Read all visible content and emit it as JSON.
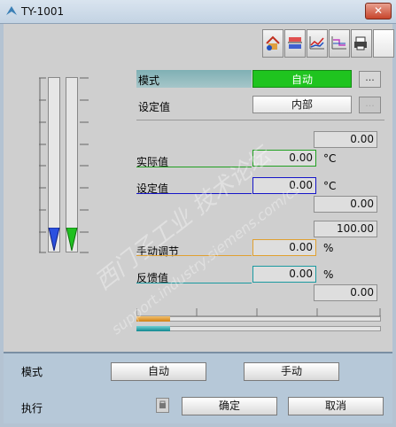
{
  "window": {
    "title": "TY-1001",
    "close_symbol": "✕"
  },
  "toolbar": {
    "icons": [
      "home-icon",
      "swap-icon",
      "trend-icon",
      "curve-icon",
      "print-icon"
    ],
    "blank_button": ""
  },
  "mode_row": {
    "label": "模式",
    "value": "自动",
    "dots": "..."
  },
  "setpoint_row": {
    "label": "设定值",
    "value": "内部",
    "dots": "..."
  },
  "values": {
    "top_value": "0.00",
    "actual_label": "实际值",
    "actual_value": "0.00",
    "actual_unit": "°C",
    "setpoint_label": "设定值",
    "setpoint_value": "0.00",
    "setpoint_unit": "°C",
    "lower_value": "0.00",
    "range_value": "100.00",
    "manual_label": "手动调节",
    "manual_value": "0.00",
    "manual_unit": "%",
    "feedback_label": "反馈值",
    "feedback_value": "0.00",
    "feedback_unit": "%",
    "bottom_value": "0.00"
  },
  "colors": {
    "actual": "#22a022",
    "setpoint": "#1515c8",
    "manual": "#e0a030",
    "feedback": "#1a9aa0",
    "auto_green": "#1fc41f"
  },
  "watermark": {
    "line1": "西门子工业 技术论坛",
    "line2": "support.industry.siemens.com/cs"
  },
  "bottom_panel": {
    "mode_label": "模式",
    "auto_button": "自动",
    "manual_button": "手动",
    "execute_label": "执行",
    "confirm_button": "确定",
    "cancel_button": "取消"
  }
}
